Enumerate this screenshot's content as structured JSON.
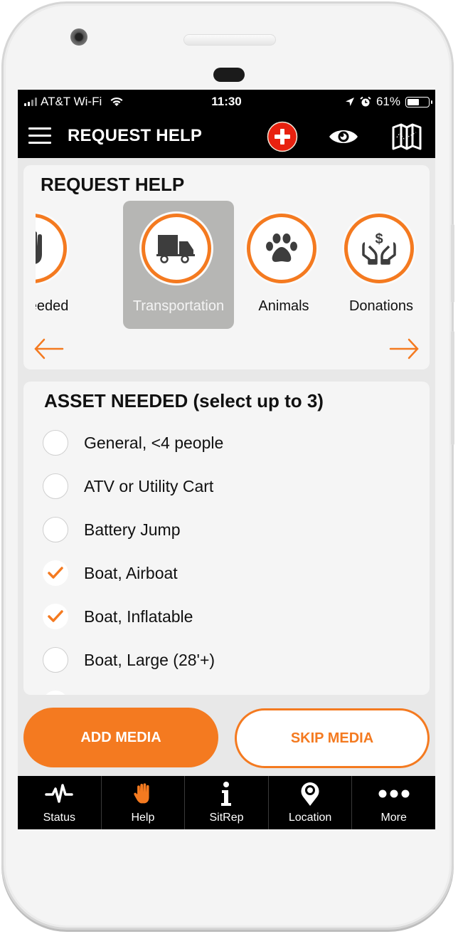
{
  "status_bar": {
    "carrier": "AT&T Wi-Fi",
    "time": "11:30",
    "battery_percent_label": "61%",
    "battery_level": 0.61
  },
  "header": {
    "title": "REQUEST HELP",
    "icons": [
      "menu-icon",
      "add-emergency-icon",
      "eye-icon",
      "map-icon"
    ]
  },
  "request_card": {
    "title": "REQUEST HELP",
    "categories": [
      {
        "label": "es Needed",
        "icon": "hand-icon",
        "selected": false
      },
      {
        "label": "Transportation",
        "icon": "truck-icon",
        "selected": true
      },
      {
        "label": "Animals",
        "icon": "paw-icon",
        "selected": false
      },
      {
        "label": "Donations",
        "icon": "donation-hands-icon",
        "selected": false
      }
    ],
    "prev_icon": "arrow-left-icon",
    "next_icon": "arrow-right-icon"
  },
  "asset_card": {
    "title": "ASSET NEEDED (select up to 3)",
    "options": [
      {
        "label": "General, <4 people",
        "checked": false
      },
      {
        "label": "ATV or Utility Cart",
        "checked": false
      },
      {
        "label": "Battery Jump",
        "checked": false
      },
      {
        "label": "Boat, Airboat",
        "checked": true
      },
      {
        "label": "Boat, Inflatable",
        "checked": true
      },
      {
        "label": "Boat, Large (28'+)",
        "checked": false
      },
      {
        "label": "",
        "checked": true
      }
    ]
  },
  "actions": {
    "add_media": "ADD MEDIA",
    "skip_media": "SKIP MEDIA"
  },
  "tabs": [
    {
      "label": "Status",
      "icon": "pulse-icon",
      "active": false
    },
    {
      "label": "Help",
      "icon": "hand-icon",
      "active": true
    },
    {
      "label": "SitRep",
      "icon": "info-icon",
      "active": false
    },
    {
      "label": "Location",
      "icon": "location-pin-icon",
      "active": false
    },
    {
      "label": "More",
      "icon": "more-dots-icon",
      "active": false
    }
  ],
  "colors": {
    "accent": "#f47a20",
    "alert_red": "#e8210f",
    "header_bg": "#000000",
    "card_bg": "#f5f5f5",
    "selected_bg": "#b6b6b4"
  }
}
